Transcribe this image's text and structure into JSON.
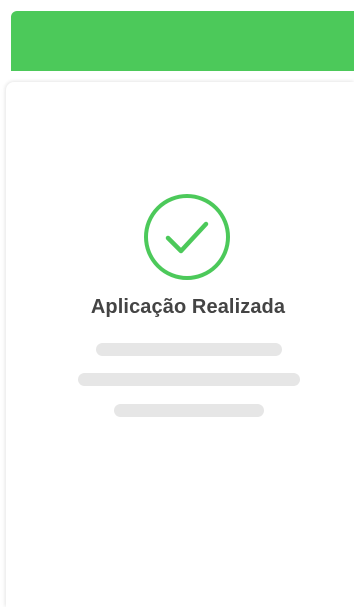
{
  "header": {
    "color": "#4cc95a"
  },
  "confirmation": {
    "icon": "check-circle-icon",
    "icon_color": "#4cc95a",
    "title": "Aplicação Realizada"
  },
  "placeholder": {
    "color": "#e6e6e6",
    "line_count": 3
  }
}
